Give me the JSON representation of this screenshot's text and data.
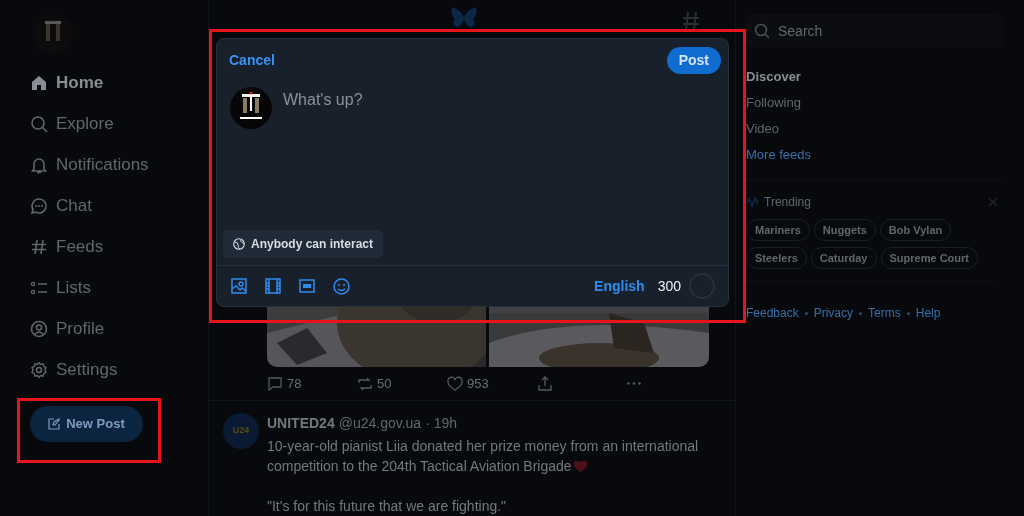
{
  "sidebar": {
    "items": [
      {
        "label": "Home",
        "selected": true
      },
      {
        "label": "Explore",
        "selected": false
      },
      {
        "label": "Notifications",
        "selected": false
      },
      {
        "label": "Chat",
        "selected": false
      },
      {
        "label": "Feeds",
        "selected": false
      },
      {
        "label": "Lists",
        "selected": false
      },
      {
        "label": "Profile",
        "selected": false
      },
      {
        "label": "Settings",
        "selected": false
      }
    ],
    "new_post_button": "New Post"
  },
  "feed": {
    "actions": [
      {
        "kind": "reply",
        "count": "78"
      },
      {
        "kind": "repost",
        "count": "50"
      },
      {
        "kind": "like",
        "count": "953"
      },
      {
        "kind": "share"
      },
      {
        "kind": "more"
      }
    ],
    "post": {
      "author": "UNITED24",
      "handle": "@u24.gov.ua",
      "time": "· 19h",
      "avatar_text": "U24",
      "paragraphs": [
        "10-year-old pianist Liia donated her prize money from an international competition to the 204th Tactical Aviation Brigade",
        "\"It's for this future that we are fighting.\""
      ]
    }
  },
  "right": {
    "search_placeholder": "Search",
    "feeds": [
      {
        "label": "Discover",
        "selected": true,
        "kind": "feed"
      },
      {
        "label": "Following",
        "selected": false,
        "kind": "feed"
      },
      {
        "label": "Video",
        "selected": false,
        "kind": "feed"
      },
      {
        "label": "More feeds",
        "selected": false,
        "kind": "link"
      }
    ],
    "trending_title": "Trending",
    "trending": [
      "Mariners",
      "Nuggets",
      "Bob Vylan",
      "Steelers",
      "Caturday",
      "Supreme Court"
    ],
    "footer_links": [
      "Feedback",
      "Privacy",
      "Terms",
      "Help"
    ]
  },
  "composer": {
    "cancel": "Cancel",
    "post": "Post",
    "placeholder": "What's up?",
    "audience": "Anybody can interact",
    "language": "English",
    "remaining": "300"
  }
}
